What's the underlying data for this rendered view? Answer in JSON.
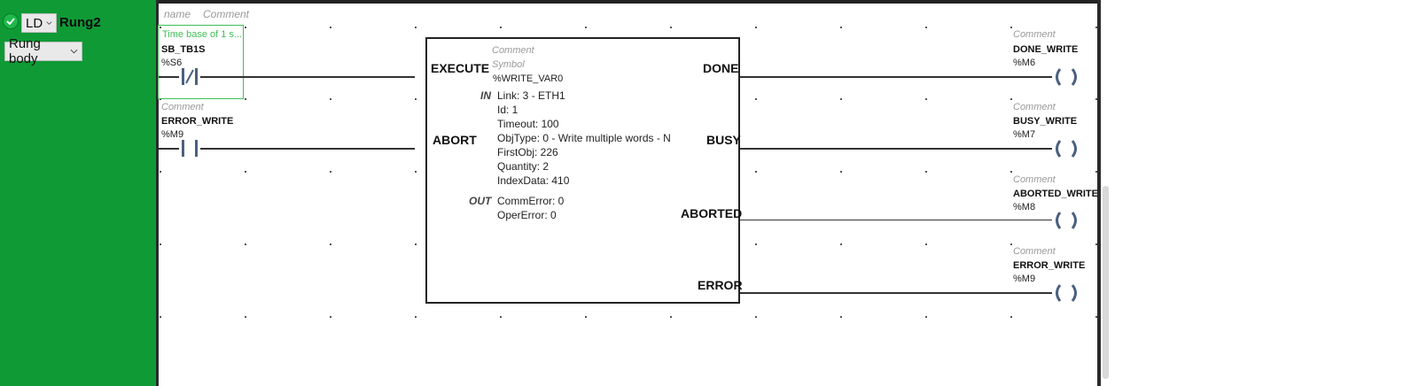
{
  "sidebar": {
    "language": "LD",
    "rung_name": "Rung2",
    "section": "Rung body"
  },
  "header": {
    "name_placeholder": "name",
    "comment_placeholder": "Comment"
  },
  "contacts": [
    {
      "comment": "Time base of 1 s...",
      "label": "SB_TB1S",
      "address": "%S6",
      "type": "normally-closed"
    },
    {
      "comment": "Comment",
      "label": "ERROR_WRITE",
      "address": "%M9",
      "type": "normally-open"
    }
  ],
  "function_block": {
    "comment": "Comment",
    "symbol_label": "Symbol",
    "instance": "%WRITE_VAR0",
    "inputs": [
      "EXECUTE",
      "ABORT"
    ],
    "outputs": [
      "DONE",
      "BUSY",
      "ABORTED",
      "ERROR"
    ],
    "in_label": "IN",
    "out_label": "OUT",
    "in_params": [
      "Link: 3 - ETH1",
      "Id: 1",
      "Timeout: 100",
      "ObjType: 0 - Write multiple words - N",
      "FirstObj: 226",
      "Quantity: 2",
      "IndexData: 410"
    ],
    "out_params": [
      "CommError: 0",
      "OperError: 0"
    ]
  },
  "coils": [
    {
      "comment": "Comment",
      "label": "DONE_WRITE",
      "address": "%M6"
    },
    {
      "comment": "Comment",
      "label": "BUSY_WRITE",
      "address": "%M7"
    },
    {
      "comment": "Comment",
      "label": "ABORTED_WRITE",
      "address": "%M8"
    },
    {
      "comment": "Comment",
      "label": "ERROR_WRITE",
      "address": "%M9"
    }
  ],
  "colors": {
    "sidebar": "#0f9a35",
    "selection": "#3fbf55",
    "wire": "#333333",
    "coil": "#4a6080"
  }
}
